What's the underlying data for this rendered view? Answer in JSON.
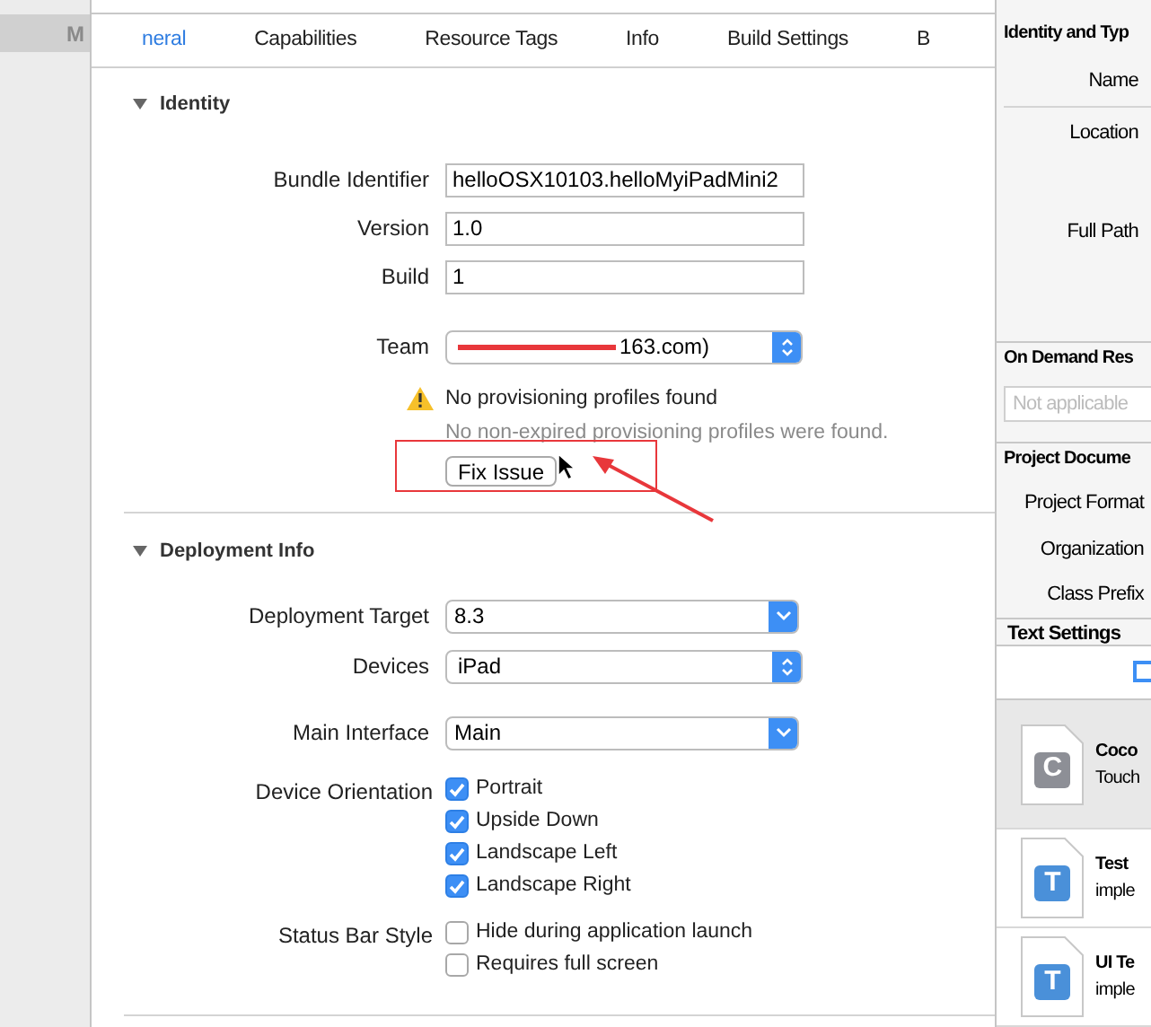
{
  "sidebar": {
    "label": "M"
  },
  "tabs": [
    {
      "label": "neral",
      "selected": true
    },
    {
      "label": "Capabilities",
      "selected": false
    },
    {
      "label": "Resource Tags",
      "selected": false
    },
    {
      "label": "Info",
      "selected": false
    },
    {
      "label": "Build Settings",
      "selected": false
    },
    {
      "label": "B",
      "selected": false
    }
  ],
  "identity": {
    "title": "Identity",
    "expanded": true,
    "fields": [
      {
        "label": "Bundle Identifier",
        "kind": "text",
        "value": "helloOSX10103.helloMyiPadMini2"
      },
      {
        "label": "Version",
        "kind": "text",
        "value": "1.0"
      },
      {
        "label": "Build",
        "kind": "text",
        "value": "1"
      },
      {
        "label": "Team",
        "kind": "popup",
        "value": "163.com)",
        "redacted": true
      }
    ],
    "warning": {
      "title": "No provisioning profiles found",
      "detail": "No non-expired provisioning profiles were found.",
      "button": "Fix Issue"
    }
  },
  "deployment": {
    "title": "Deployment Info",
    "expanded": true,
    "fields": [
      {
        "label": "Deployment Target",
        "kind": "combo",
        "value": "8.3"
      },
      {
        "label": "Devices",
        "kind": "popup",
        "value": "iPad"
      },
      {
        "label": "Main Interface",
        "kind": "combo",
        "value": "Main"
      }
    ],
    "orientation": {
      "label": "Device Orientation",
      "options": [
        {
          "label": "Portrait",
          "checked": true
        },
        {
          "label": "Upside Down",
          "checked": true
        },
        {
          "label": "Landscape Left",
          "checked": true
        },
        {
          "label": "Landscape Right",
          "checked": true
        }
      ]
    },
    "status_bar": {
      "label": "Status Bar Style",
      "options": [
        {
          "label": "Hide during application launch",
          "checked": false
        },
        {
          "label": "Requires full screen",
          "checked": false
        }
      ]
    }
  },
  "inspector": {
    "identity_title": "Identity and Typ",
    "name_label": "Name",
    "location_label": "Location",
    "full_path_label": "Full Path",
    "on_demand_title": "On Demand Res",
    "on_demand_placeholder": "Not applicable",
    "project_title": "Project Docume",
    "project_rows": [
      "Project Format",
      "Organization",
      "Class Prefix"
    ],
    "text_settings_title": "Text Settings",
    "templates": [
      {
        "letter": "C",
        "title": "Coco",
        "subtitle": "Touch",
        "selected": true
      },
      {
        "letter": "T",
        "title": "Test",
        "subtitle": "imple",
        "selected": false
      },
      {
        "letter": "T",
        "title": "UI Te",
        "subtitle": "imple",
        "selected": false
      }
    ]
  }
}
